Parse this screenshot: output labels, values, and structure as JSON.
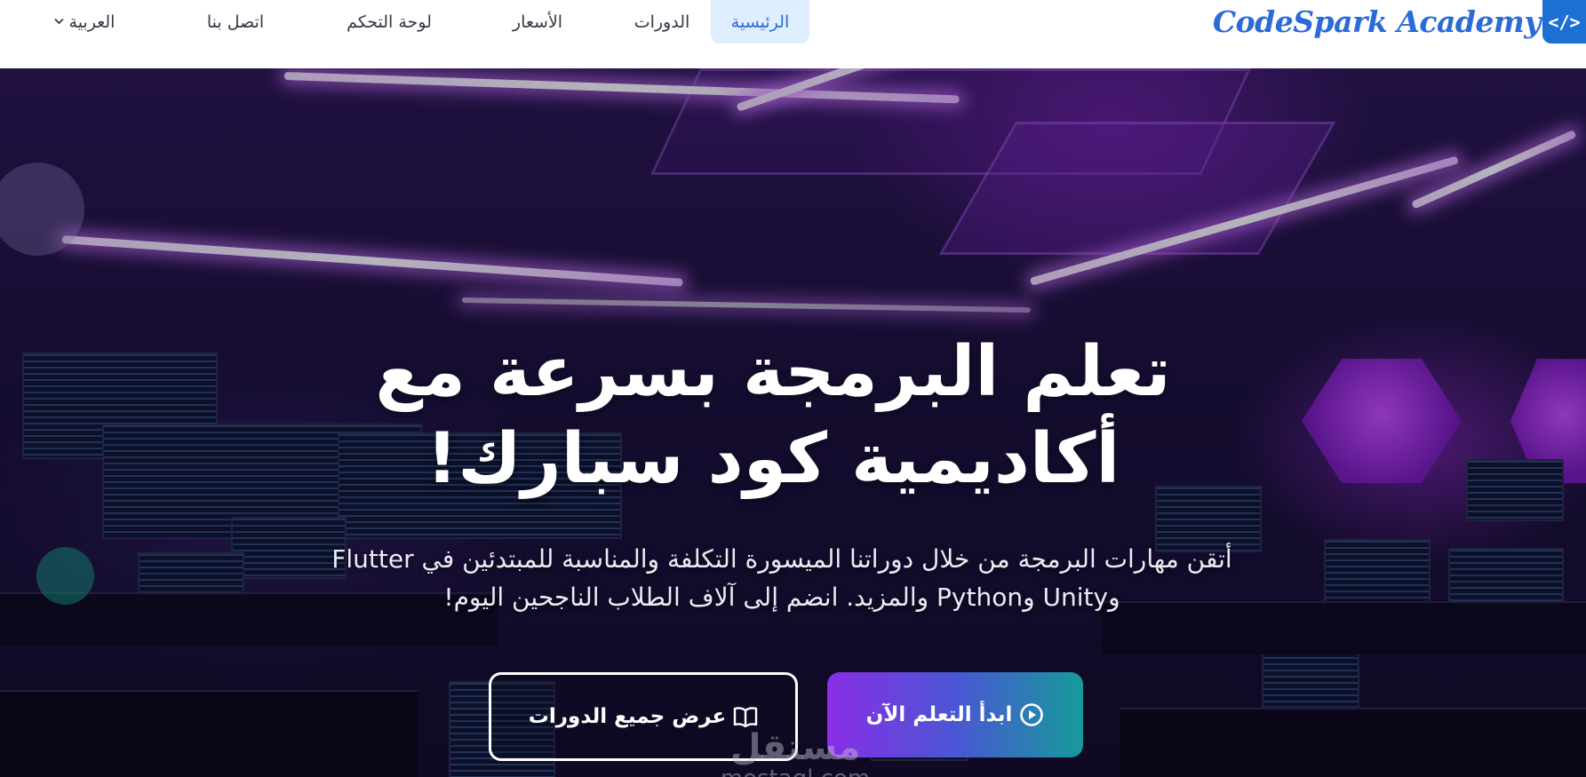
{
  "header": {
    "logo": {
      "text": "CodeSpark Academy",
      "icon": "code-brackets-icon",
      "icon_glyph": "</>"
    },
    "nav": [
      {
        "label": "الرئيسية",
        "active": true
      },
      {
        "label": "الدورات",
        "active": false
      },
      {
        "label": "الأسعار",
        "active": false
      },
      {
        "label": "لوحة التحكم",
        "active": false
      },
      {
        "label": "اتصل بنا",
        "active": false
      }
    ],
    "language": {
      "selected": "العربية",
      "icon": "chevron-down-icon"
    }
  },
  "hero": {
    "title": "تعلم البرمجة بسرعة مع أكاديمية كود سبارك!",
    "subtitle": "أتقن مهارات البرمجة من خلال دوراتنا الميسورة التكلفة والمناسبة للمبتدئين في Flutter وUnity وPython والمزيد. انضم إلى آلاف الطلاب الناجحين اليوم!",
    "primary_button": {
      "label": "ابدأ التعلم الآن",
      "icon": "play-circle-icon"
    },
    "secondary_button": {
      "label": "عرض جميع الدورات",
      "icon": "book-open-icon"
    }
  },
  "watermark": {
    "arabic": "مستقل",
    "latin": "mostaql.com"
  },
  "colors": {
    "brand": "#2a6bd8",
    "nav_active_bg": "#dfeeff",
    "primary_gradient": [
      "#8a2ee6",
      "#4a56d4",
      "#169a9a"
    ]
  }
}
